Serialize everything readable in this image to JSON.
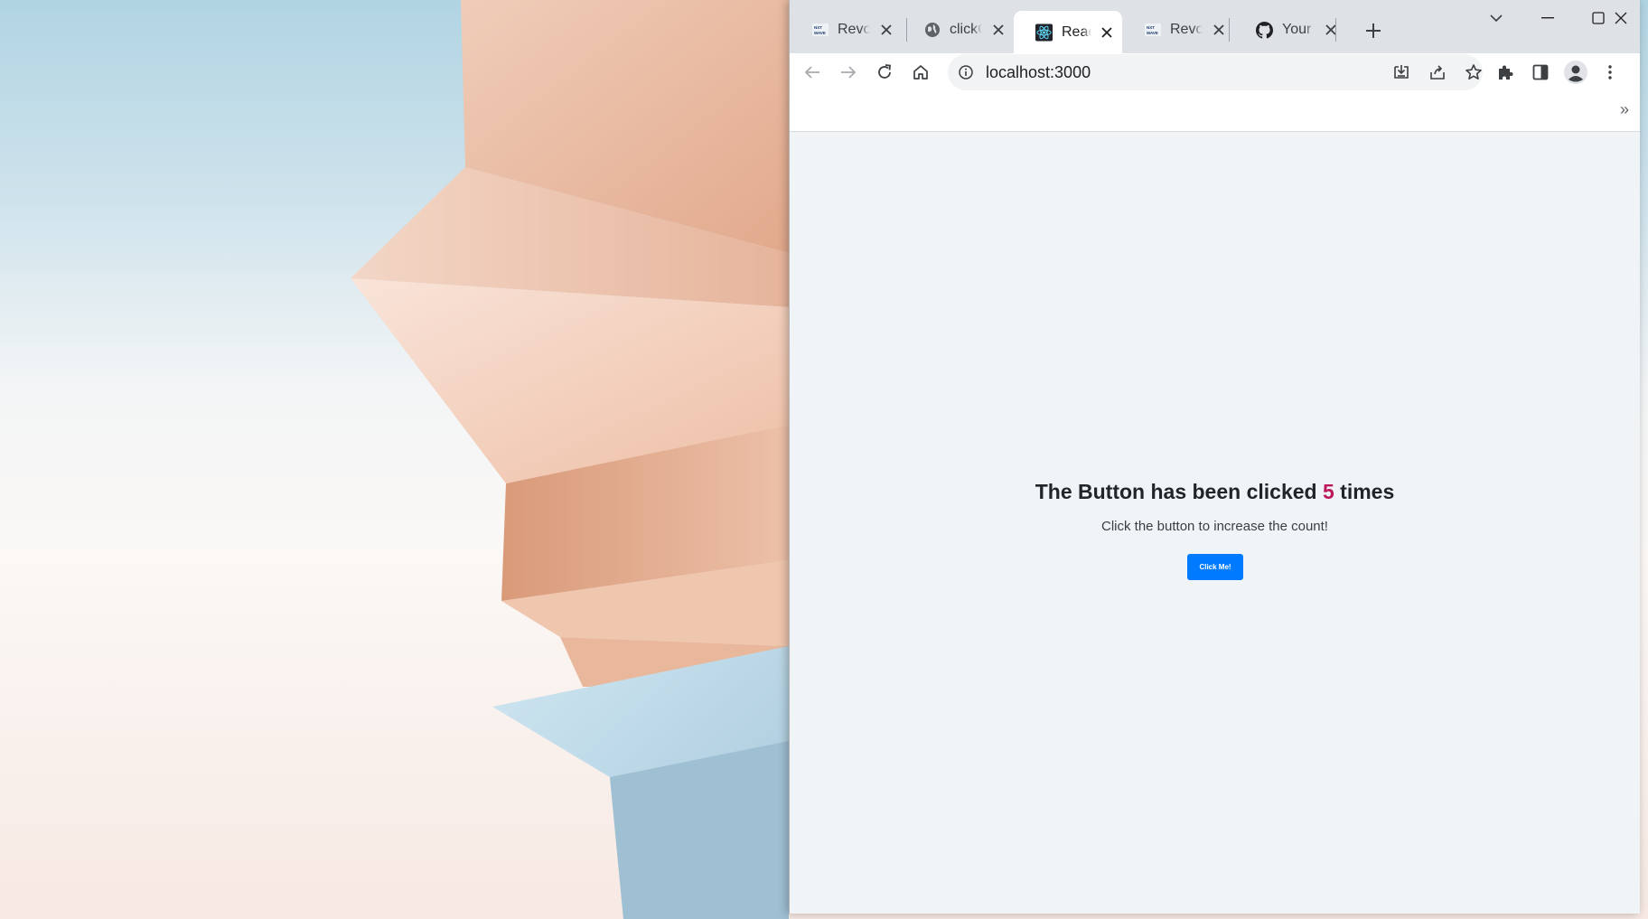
{
  "browser": {
    "tabs": [
      {
        "title": "Revolu",
        "favicon": "nxtwave-icon",
        "active": false
      },
      {
        "title": "clickC",
        "favicon": "globe-icon",
        "active": false
      },
      {
        "title": "React",
        "favicon": "react-icon",
        "active": true
      },
      {
        "title": "Revolu",
        "favicon": "nxtwave-icon",
        "active": false
      },
      {
        "title": "Your F",
        "favicon": "github-icon",
        "active": false
      }
    ],
    "url": "localhost:3000",
    "bookmarks_overflow": "»"
  },
  "page": {
    "heading_prefix": "The Button has been clicked ",
    "count": "5",
    "heading_suffix": " times",
    "subtext": "Click the button to increase the count!",
    "button_label": "Click Me!"
  },
  "colors": {
    "count_color": "#be185d",
    "button_bg": "#007bff",
    "page_bg": "#f1f4f7"
  }
}
